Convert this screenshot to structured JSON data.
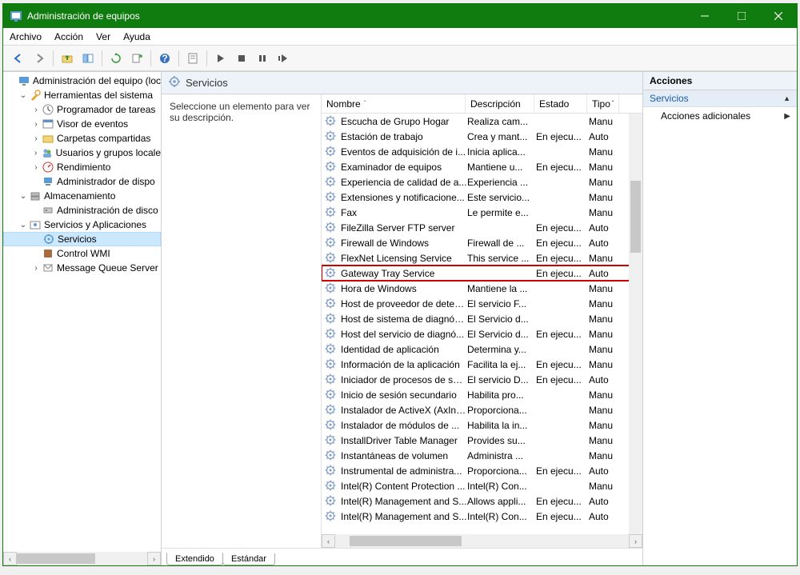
{
  "window": {
    "title": "Administración de equipos"
  },
  "menu": {
    "archivo": "Archivo",
    "accion": "Acción",
    "ver": "Ver",
    "ayuda": "Ayuda"
  },
  "tree": {
    "root": "Administración del equipo (loc",
    "herramientas": "Herramientas del sistema",
    "programador": "Programador de tareas",
    "visor": "Visor de eventos",
    "carpetas": "Carpetas compartidas",
    "usuarios": "Usuarios y grupos locale",
    "rendimiento": "Rendimiento",
    "admdispo": "Administrador de dispo",
    "almacenamiento": "Almacenamiento",
    "admdisc": "Administración de disco",
    "servapps": "Servicios y Aplicaciones",
    "servicios": "Servicios",
    "controlwmi": "Control WMI",
    "msgqueue": "Message Queue Server"
  },
  "mid": {
    "title": "Servicios",
    "desc": "Seleccione un elemento para ver su descripción.",
    "col_nombre": "Nombre",
    "col_descripcion": "Descripción",
    "col_estado": "Estado",
    "col_tipo": "Tipo"
  },
  "tabs": {
    "extendido": "Extendido",
    "estandar": "Estándar"
  },
  "right": {
    "header": "Acciones",
    "section": "Servicios",
    "item": "Acciones adicionales"
  },
  "services": [
    {
      "name": "Escucha de Grupo Hogar",
      "desc": "Realiza cam...",
      "estado": "",
      "tipo": "Manu"
    },
    {
      "name": "Estación de trabajo",
      "desc": "Crea y mant...",
      "estado": "En ejecu...",
      "tipo": "Auto"
    },
    {
      "name": "Eventos de adquisición de i...",
      "desc": "Inicia aplica...",
      "estado": "",
      "tipo": "Manu"
    },
    {
      "name": "Examinador de equipos",
      "desc": "Mantiene u...",
      "estado": "En ejecu...",
      "tipo": "Manu"
    },
    {
      "name": "Experiencia de calidad de a...",
      "desc": "Experiencia ...",
      "estado": "",
      "tipo": "Manu"
    },
    {
      "name": "Extensiones y notificacione...",
      "desc": "Este servicio...",
      "estado": "",
      "tipo": "Manu"
    },
    {
      "name": "Fax",
      "desc": "Le permite e...",
      "estado": "",
      "tipo": "Manu"
    },
    {
      "name": "FileZilla Server FTP server",
      "desc": "",
      "estado": "En ejecu...",
      "tipo": "Auto"
    },
    {
      "name": "Firewall de Windows",
      "desc": "Firewall de ...",
      "estado": "En ejecu...",
      "tipo": "Auto"
    },
    {
      "name": "FlexNet Licensing Service",
      "desc": "This service ...",
      "estado": "En ejecu...",
      "tipo": "Manu"
    },
    {
      "name": "Gateway Tray Service",
      "desc": "",
      "estado": "En ejecu...",
      "tipo": "Auto",
      "highlight": true
    },
    {
      "name": "Hora de Windows",
      "desc": "Mantiene la ...",
      "estado": "",
      "tipo": "Manu"
    },
    {
      "name": "Host de proveedor de detec...",
      "desc": "El servicio F...",
      "estado": "",
      "tipo": "Manu"
    },
    {
      "name": "Host de sistema de diagnós...",
      "desc": "El Servicio d...",
      "estado": "",
      "tipo": "Manu"
    },
    {
      "name": "Host del servicio de diagnó...",
      "desc": "El Servicio d...",
      "estado": "En ejecu...",
      "tipo": "Manu"
    },
    {
      "name": "Identidad de aplicación",
      "desc": "Determina y...",
      "estado": "",
      "tipo": "Manu"
    },
    {
      "name": "Información de la aplicación",
      "desc": "Facilita la ej...",
      "estado": "En ejecu...",
      "tipo": "Manu"
    },
    {
      "name": "Iniciador de procesos de ser...",
      "desc": "El servicio D...",
      "estado": "En ejecu...",
      "tipo": "Auto"
    },
    {
      "name": "Inicio de sesión secundario",
      "desc": "Habilita pro...",
      "estado": "",
      "tipo": "Manu"
    },
    {
      "name": "Instalador de ActiveX (AxIns...",
      "desc": "Proporciona...",
      "estado": "",
      "tipo": "Manu"
    },
    {
      "name": "Instalador de módulos de ...",
      "desc": "Habilita la in...",
      "estado": "",
      "tipo": "Manu"
    },
    {
      "name": "InstallDriver Table Manager",
      "desc": "Provides su...",
      "estado": "",
      "tipo": "Manu"
    },
    {
      "name": "Instantáneas de volumen",
      "desc": "Administra ...",
      "estado": "",
      "tipo": "Manu"
    },
    {
      "name": "Instrumental de administra...",
      "desc": "Proporciona...",
      "estado": "En ejecu...",
      "tipo": "Auto"
    },
    {
      "name": "Intel(R) Content Protection ...",
      "desc": "Intel(R) Con...",
      "estado": "",
      "tipo": "Manu"
    },
    {
      "name": "Intel(R) Management and S...",
      "desc": "Allows appli...",
      "estado": "En ejecu...",
      "tipo": "Auto"
    },
    {
      "name": "Intel(R) Management and S...",
      "desc": "Intel(R) Con...",
      "estado": "En ejecu...",
      "tipo": "Auto"
    }
  ]
}
